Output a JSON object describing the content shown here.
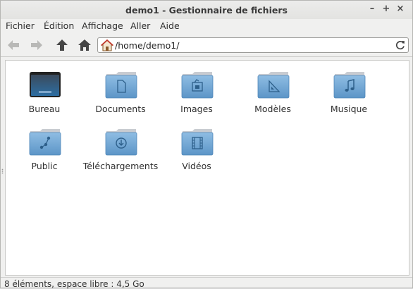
{
  "window": {
    "title": "demo1 - Gestionnaire de fichiers",
    "controls": {
      "minimize": "–",
      "maximize": "+",
      "close": "×"
    }
  },
  "menu": {
    "items": [
      {
        "label": "Fichier"
      },
      {
        "label": "Édition"
      },
      {
        "label": "Affichage"
      },
      {
        "label": "Aller"
      },
      {
        "label": "Aide"
      }
    ]
  },
  "toolbar": {
    "back_icon": "arrow-left-icon",
    "forward_icon": "arrow-right-icon",
    "up_icon": "arrow-up-icon",
    "home_icon": "home-icon"
  },
  "location": {
    "path": "/home/demo1/",
    "reload_icon": "reload-icon"
  },
  "files": [
    {
      "label": "Bureau",
      "icon": "desktop-folder-icon"
    },
    {
      "label": "Documents",
      "icon": "documents-folder-icon"
    },
    {
      "label": "Images",
      "icon": "pictures-folder-icon"
    },
    {
      "label": "Modèles",
      "icon": "templates-folder-icon"
    },
    {
      "label": "Musique",
      "icon": "music-folder-icon"
    },
    {
      "label": "Public",
      "icon": "public-folder-icon"
    },
    {
      "label": "Téléchargements",
      "icon": "downloads-folder-icon"
    },
    {
      "label": "Vidéos",
      "icon": "videos-folder-icon"
    }
  ],
  "status": {
    "text": "8 éléments, espace libre : 4,5 Go"
  },
  "colors": {
    "folder_top": "#8fbde3",
    "folder_bottom": "#5c95c7",
    "folder_tab": "#c9ccd1"
  }
}
